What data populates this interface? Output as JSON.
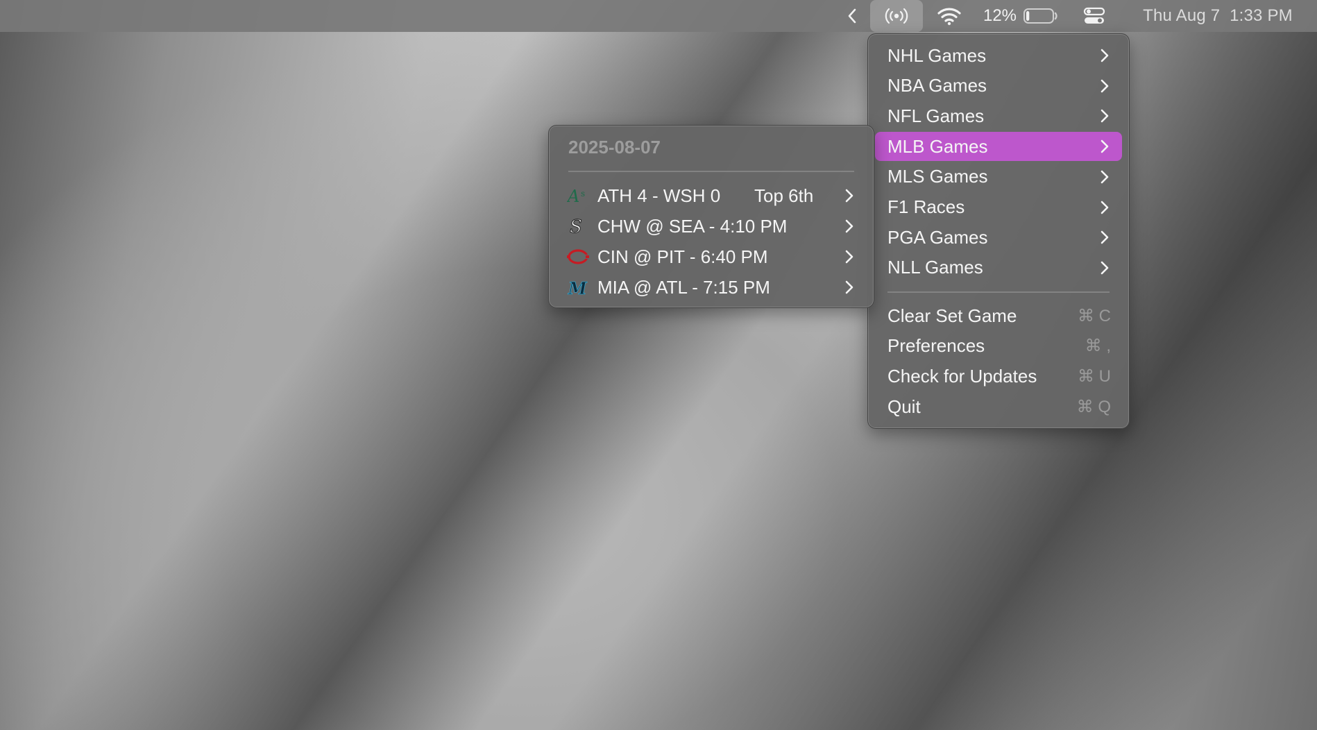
{
  "menubar": {
    "battery_percent": "12%",
    "battery_level": 0.12,
    "clock": "Thu Aug 7  1:33 PM"
  },
  "main_menu": {
    "sports_items": [
      {
        "label": "NHL Games"
      },
      {
        "label": "NBA Games"
      },
      {
        "label": "NFL Games"
      },
      {
        "label": "MLB Games",
        "highlighted": true
      },
      {
        "label": "MLS Games"
      },
      {
        "label": "F1 Races"
      },
      {
        "label": "PGA Games"
      },
      {
        "label": "NLL Games"
      }
    ],
    "action_items": [
      {
        "label": "Clear Set Game",
        "shortcut": "⌘ C"
      },
      {
        "label": "Preferences",
        "shortcut": "⌘ ,"
      },
      {
        "label": "Check for Updates",
        "shortcut": "⌘ U"
      },
      {
        "label": "Quit",
        "shortcut": "⌘ Q"
      }
    ],
    "highlight_color": "#bd57cc"
  },
  "sub_menu": {
    "header": "2025-08-07",
    "games": [
      {
        "logo": "athletics-logo-icon",
        "label": "ATH 4 - WSH 0",
        "status": "Top 6th"
      },
      {
        "logo": "white-sox-logo-icon",
        "label": "CHW @ SEA - 4:10 PM",
        "status": ""
      },
      {
        "logo": "reds-logo-icon",
        "label": "CIN @ PIT - 6:40 PM",
        "status": ""
      },
      {
        "logo": "marlins-logo-icon",
        "label": "MIA @ ATL - 7:15 PM",
        "status": ""
      }
    ]
  }
}
